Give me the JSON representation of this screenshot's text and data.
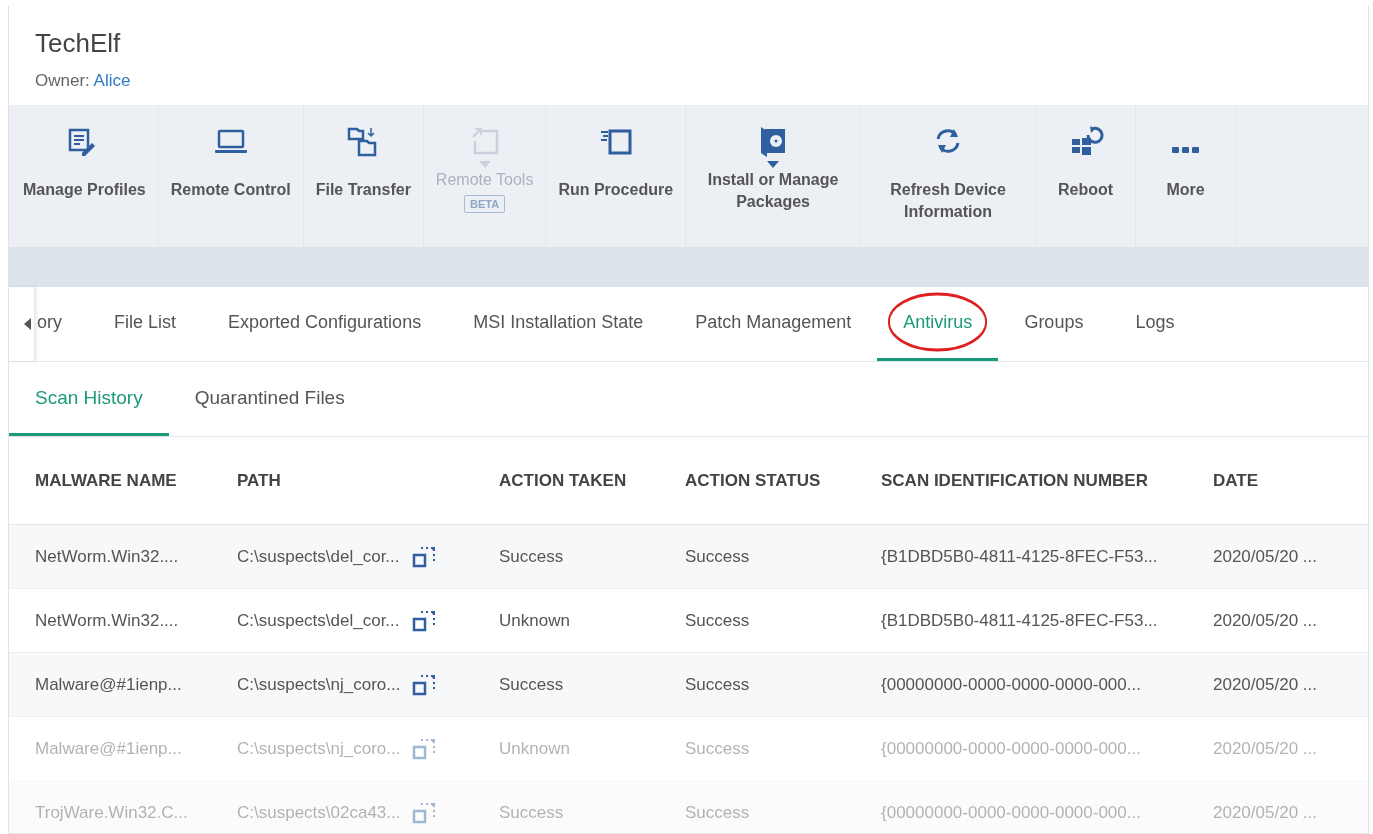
{
  "device": {
    "title": "TechElf",
    "owner_label": "Owner:",
    "owner": "Alice"
  },
  "toolbar": [
    {
      "label": "Manage Profiles",
      "kind": "profiles",
      "disabled": false,
      "dropdown": false
    },
    {
      "label": "Remote Control",
      "kind": "laptop",
      "disabled": false,
      "dropdown": false
    },
    {
      "label": "File Transfer",
      "kind": "transfer",
      "disabled": false,
      "dropdown": false
    },
    {
      "label": "Remote Tools",
      "kind": "tools",
      "disabled": true,
      "dropdown": true,
      "badge": "BETA"
    },
    {
      "label": "Run Procedure",
      "kind": "procedure",
      "disabled": false,
      "dropdown": false
    },
    {
      "label": "Install or Manage Packages",
      "kind": "package",
      "disabled": false,
      "dropdown": true
    },
    {
      "label": "Refresh Device Information",
      "kind": "refresh",
      "disabled": false,
      "dropdown": false
    },
    {
      "label": "Reboot",
      "kind": "reboot",
      "disabled": false,
      "dropdown": false
    },
    {
      "label": "More",
      "kind": "more",
      "disabled": false,
      "dropdown": false
    }
  ],
  "tabs": [
    {
      "label": "ory",
      "selected": false,
      "circled": false
    },
    {
      "label": "File List",
      "selected": false,
      "circled": false
    },
    {
      "label": "Exported Configurations",
      "selected": false,
      "circled": false
    },
    {
      "label": "MSI Installation State",
      "selected": false,
      "circled": false
    },
    {
      "label": "Patch Management",
      "selected": false,
      "circled": false
    },
    {
      "label": "Antivirus",
      "selected": true,
      "circled": true
    },
    {
      "label": "Groups",
      "selected": false,
      "circled": false
    },
    {
      "label": "Logs",
      "selected": false,
      "circled": false
    }
  ],
  "subtabs": [
    {
      "label": "Scan History",
      "selected": true
    },
    {
      "label": "Quarantined Files",
      "selected": false
    }
  ],
  "table": {
    "columns": [
      "MALWARE NAME",
      "PATH",
      "ACTION TAKEN",
      "ACTION STATUS",
      "SCAN IDENTIFICATION NUMBER",
      "DATE"
    ],
    "rows": [
      {
        "faded": false,
        "cells": [
          "NetWorm.Win32....",
          "C:\\suspects\\del_cor...",
          "Success",
          "Success",
          "{B1DBD5B0-4811-4125-8FEC-F53...",
          "2020/05/20 ..."
        ]
      },
      {
        "faded": false,
        "cells": [
          "NetWorm.Win32....",
          "C:\\suspects\\del_cor...",
          "Unknown",
          "Success",
          "{B1DBD5B0-4811-4125-8FEC-F53...",
          "2020/05/20 ..."
        ]
      },
      {
        "faded": false,
        "cells": [
          "Malware@#1ienp...",
          "C:\\suspects\\nj_coro...",
          "Success",
          "Success",
          "{00000000-0000-0000-0000-000...",
          "2020/05/20 ..."
        ]
      },
      {
        "faded": true,
        "cells": [
          "Malware@#1ienp...",
          "C:\\suspects\\nj_coro...",
          "Unknown",
          "Success",
          "{00000000-0000-0000-0000-000...",
          "2020/05/20 ..."
        ]
      },
      {
        "faded": true,
        "cells": [
          "TrojWare.Win32.C...",
          "C:\\suspects\\02ca43...",
          "Success",
          "Success",
          "{00000000-0000-0000-0000-000...",
          "2020/05/20 ..."
        ]
      }
    ]
  }
}
